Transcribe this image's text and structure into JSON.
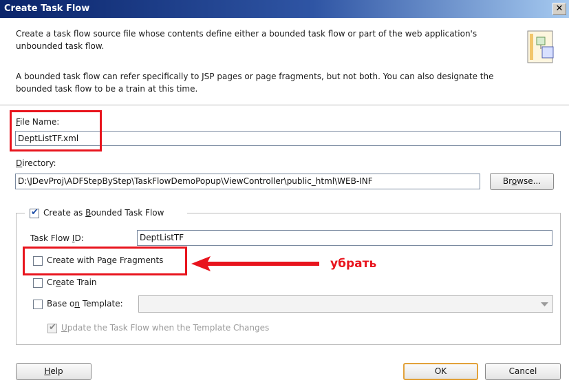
{
  "window": {
    "title": "Create Task Flow",
    "close_glyph": "✕"
  },
  "description": {
    "paragraph1": "Create a task flow source file whose contents define either a bounded task flow or part of the web application's unbounded task flow.",
    "paragraph2": "A bounded task flow can refer specifically to JSP pages or page fragments, but not both.  You can also designate the bounded task flow to be a train at this time.",
    "icon": "task-flow-wizard-icon"
  },
  "form": {
    "file_name": {
      "label_mnemonic": "F",
      "label_rest": "ile Name:",
      "value": "DeptListTF.xml"
    },
    "directory": {
      "label_mnemonic": "D",
      "label_rest": "irectory:",
      "value": "D:\\JDevProj\\ADFStepByStep\\TaskFlowDemoPopup\\ViewController\\public_html\\WEB-INF"
    },
    "browse_button": {
      "before": "Br",
      "mnemonic": "o",
      "after": "wse..."
    }
  },
  "bounded_group": {
    "legend_before": "Create as ",
    "legend_mnemonic": "B",
    "legend_after": "ounded Task Flow",
    "checked": true,
    "task_flow_id": {
      "label_before": "Task Flow ",
      "label_mnemonic": "I",
      "label_after": "D:",
      "value": "DeptListTF"
    },
    "page_fragments": {
      "before": "Create with Pa",
      "mnemonic": "g",
      "after": "e Fragments",
      "checked": false
    },
    "create_train": {
      "before": "Cr",
      "mnemonic": "e",
      "after": "ate Train",
      "checked": false
    },
    "base_on_template": {
      "before": "Base o",
      "mnemonic": "n",
      "after": " Template:",
      "checked": false,
      "value": ""
    },
    "update_task_flow": {
      "mnemonic": "U",
      "after": "pdate the Task Flow when the Template Changes",
      "checked": true,
      "disabled": true
    }
  },
  "annotation": {
    "text": "убрать",
    "color": "#e8141d"
  },
  "buttons": {
    "help": {
      "mnemonic": "H",
      "after": "elp"
    },
    "ok": "OK",
    "cancel": "Cancel"
  },
  "check_glyph": "✔",
  "colors": {
    "titlebar_start": "#0a246a",
    "highlight_red": "#e8141d",
    "default_button_border": "#e2a23a"
  }
}
